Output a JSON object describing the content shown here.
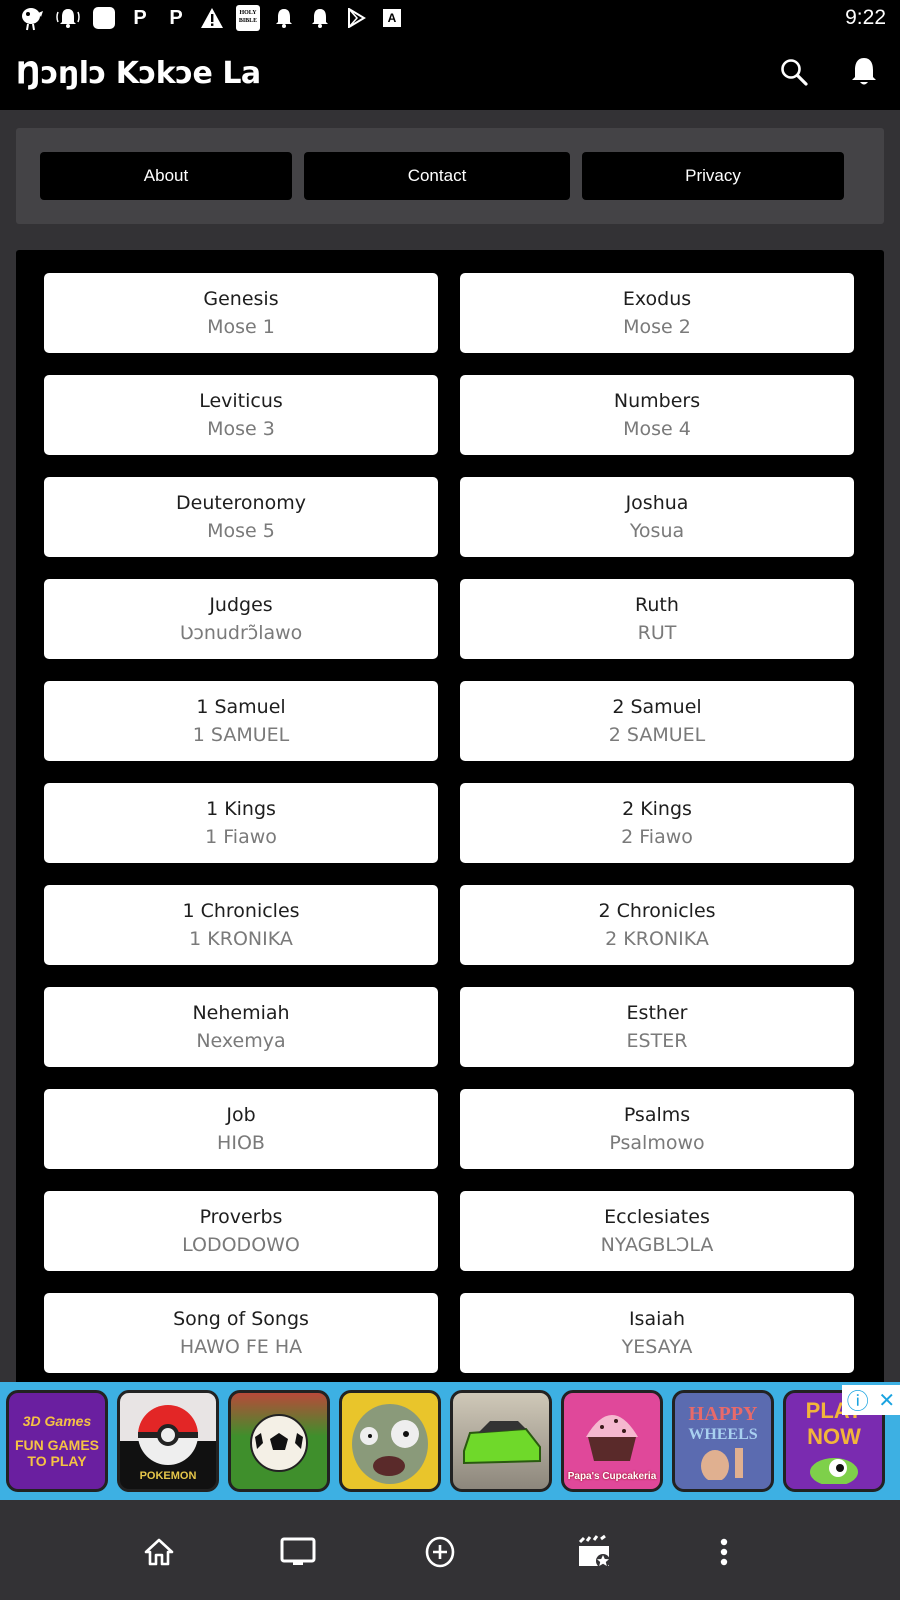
{
  "status_bar": {
    "time": "9:22",
    "icons": [
      "app-mascot-icon",
      "ringing-bell-icon",
      "rounded-square-icon",
      "p-icon",
      "p-icon",
      "warning-icon",
      "holy-bible-icon",
      "bell-icon",
      "bell-icon",
      "play-store-icon",
      "a-box-icon"
    ],
    "bible_label": "HOLY BIBLE",
    "p_label": "P",
    "a_label": "A",
    "warning_label": "!"
  },
  "app_bar": {
    "title": "Ŋɔŋlɔ Kɔkɔe La",
    "actions": [
      "search-icon",
      "notifications-bell-icon"
    ]
  },
  "nav_buttons": [
    {
      "label": "About"
    },
    {
      "label": "Contact"
    },
    {
      "label": "Privacy"
    }
  ],
  "books": [
    {
      "title": "Genesis",
      "subtitle": "Mose 1"
    },
    {
      "title": "Exodus",
      "subtitle": "Mose 2"
    },
    {
      "title": "Leviticus",
      "subtitle": "Mose 3"
    },
    {
      "title": "Numbers",
      "subtitle": "Mose 4"
    },
    {
      "title": "Deuteronomy",
      "subtitle": "Mose 5"
    },
    {
      "title": "Joshua",
      "subtitle": "Yosua"
    },
    {
      "title": "Judges",
      "subtitle": "Ʋɔnudrɔ̃lawo"
    },
    {
      "title": "Ruth",
      "subtitle": "RUT"
    },
    {
      "title": "1 Samuel",
      "subtitle": "1 SAMUEL"
    },
    {
      "title": "2 Samuel",
      "subtitle": "2 SAMUEL"
    },
    {
      "title": "1 Kings",
      "subtitle": "1 Fiawo"
    },
    {
      "title": "2 Kings",
      "subtitle": "2 Fiawo"
    },
    {
      "title": "1 Chronicles",
      "subtitle": "1 KRONIKA"
    },
    {
      "title": "2 Chronicles",
      "subtitle": "2 KRONIKA"
    },
    {
      "title": "Nehemiah",
      "subtitle": "Nexemya"
    },
    {
      "title": "Esther",
      "subtitle": "ESTER"
    },
    {
      "title": "Job",
      "subtitle": "HIOB"
    },
    {
      "title": "Psalms",
      "subtitle": "Psalmowo"
    },
    {
      "title": "Proverbs",
      "subtitle": "LODODOWO"
    },
    {
      "title": "Ecclesiates",
      "subtitle": "NYAGBLƆLA"
    },
    {
      "title": "Song of Songs",
      "subtitle": "HAWO FE HA"
    },
    {
      "title": "Isaiah",
      "subtitle": "YESAYA"
    }
  ],
  "ad": {
    "tiles": [
      {
        "name": "3d-games",
        "line1": "3D Games",
        "line2": "FUN GAMES TO PLAY",
        "bg": "#6a1fa0",
        "fg": "#f5c244"
      },
      {
        "name": "pokemon",
        "line1": "",
        "line2": "POKEMON",
        "bg": "#e8e4e4",
        "fg": "#e5c64a"
      },
      {
        "name": "soccer",
        "line1": "",
        "line2": "",
        "bg": "#3f8f2c",
        "fg": "#ffffff"
      },
      {
        "name": "zombie",
        "line1": "",
        "line2": "",
        "bg": "#e9c52b",
        "fg": "#7a8a6a"
      },
      {
        "name": "racing-car",
        "line1": "",
        "line2": "",
        "bg": "#b9b3a7",
        "fg": "#6fd92a"
      },
      {
        "name": "papas-cupcakeria",
        "line1": "",
        "line2": "Papa's Cupcakeria",
        "bg": "#e0489a",
        "fg": "#f5b8cf"
      },
      {
        "name": "happy-wheels",
        "line1": "HAPPY",
        "line2": "WHEELS",
        "bg": "#5b6bb0",
        "fg": "#e86a6a"
      },
      {
        "name": "play-now",
        "line1": "PLAY",
        "line2": "NOW",
        "bg": "#7a2bb0",
        "fg": "#f2b53a"
      }
    ],
    "info_icon": "ⓘ",
    "close_icon": "✕"
  },
  "bottom_nav": [
    "home-icon",
    "tv-icon",
    "add-circle-icon",
    "clapperboard-star-icon",
    "more-vert-icon"
  ]
}
